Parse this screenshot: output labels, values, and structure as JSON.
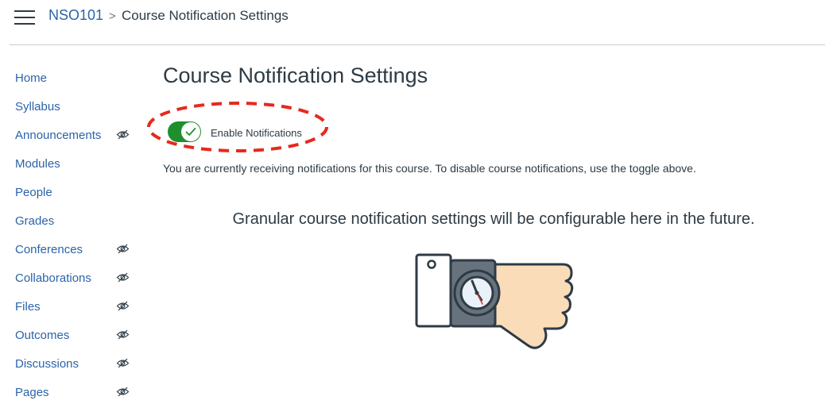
{
  "header": {
    "menu_icon": "hamburger-icon",
    "breadcrumb": {
      "course": "NSO101",
      "separator": ">",
      "current": "Course Notification Settings"
    }
  },
  "sidebar": {
    "items": [
      {
        "label": "Home",
        "hidden_icon": false
      },
      {
        "label": "Syllabus",
        "hidden_icon": false
      },
      {
        "label": "Announcements",
        "hidden_icon": true
      },
      {
        "label": "Modules",
        "hidden_icon": false
      },
      {
        "label": "People",
        "hidden_icon": false
      },
      {
        "label": "Grades",
        "hidden_icon": false
      },
      {
        "label": "Conferences",
        "hidden_icon": true
      },
      {
        "label": "Collaborations",
        "hidden_icon": true
      },
      {
        "label": "Files",
        "hidden_icon": true
      },
      {
        "label": "Outcomes",
        "hidden_icon": true
      },
      {
        "label": "Discussions",
        "hidden_icon": true
      },
      {
        "label": "Pages",
        "hidden_icon": true
      }
    ],
    "hidden_icon_name": "eye-slash-icon"
  },
  "main": {
    "title": "Course Notification Settings",
    "toggle": {
      "label": "Enable Notifications",
      "checked": true,
      "icon": "checkmark-icon"
    },
    "status_text": "You are currently receiving notifications for this course. To disable course notifications, use the toggle above.",
    "future_text": "Granular course notification settings will be configurable here in the future.",
    "illustration": "wristwatch-illustration"
  },
  "colors": {
    "link": "#2b63a9",
    "text": "#2d3b45",
    "toggle_on": "#1f8f2e",
    "annotation": "#e8281c",
    "divider": "#c7cdd1"
  }
}
